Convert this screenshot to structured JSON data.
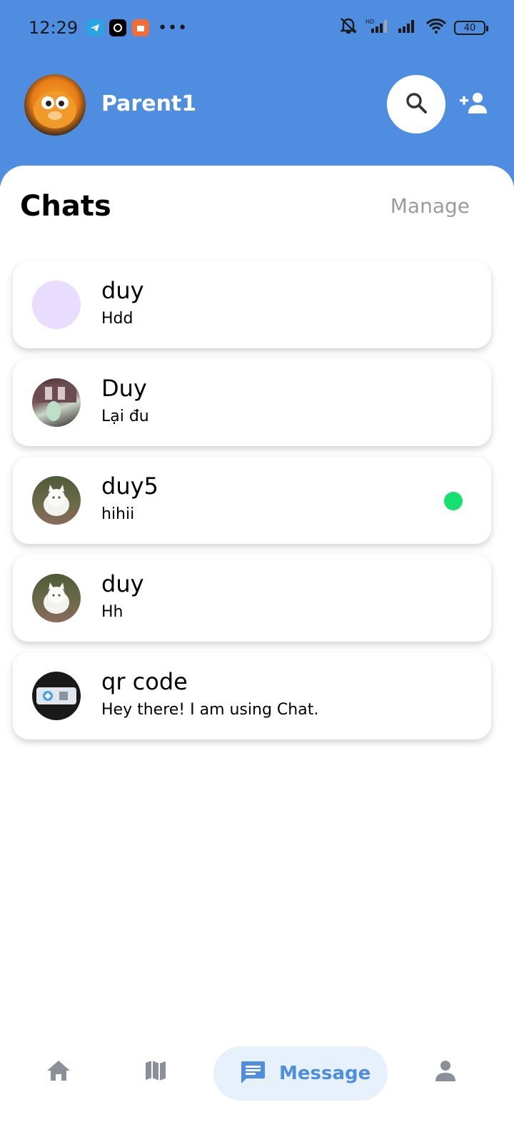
{
  "status_bar": {
    "time": "12:29",
    "dots": "•••",
    "battery": "40"
  },
  "header": {
    "profile_name": "Parent1"
  },
  "chats": {
    "title": "Chats",
    "manage_label": "Manage",
    "items": [
      {
        "name": "duy",
        "message": "Hdd",
        "online": false
      },
      {
        "name": "Duy",
        "message": "Lại đu",
        "online": false
      },
      {
        "name": "duy5",
        "message": "hihii",
        "online": true
      },
      {
        "name": "duy",
        "message": "Hh",
        "online": false
      },
      {
        "name": "qr code",
        "message": "Hey there! I am using Chat.",
        "online": false
      }
    ]
  },
  "bottom_nav": {
    "items": [
      {
        "icon": "home-icon"
      },
      {
        "icon": "map-icon"
      },
      {
        "icon": "message-icon",
        "label": "Message",
        "active": true
      },
      {
        "icon": "person-icon"
      }
    ]
  },
  "colors": {
    "header": "#4e8ddf",
    "online": "#16e070",
    "active_nav_bg": "#e6f1fc"
  }
}
